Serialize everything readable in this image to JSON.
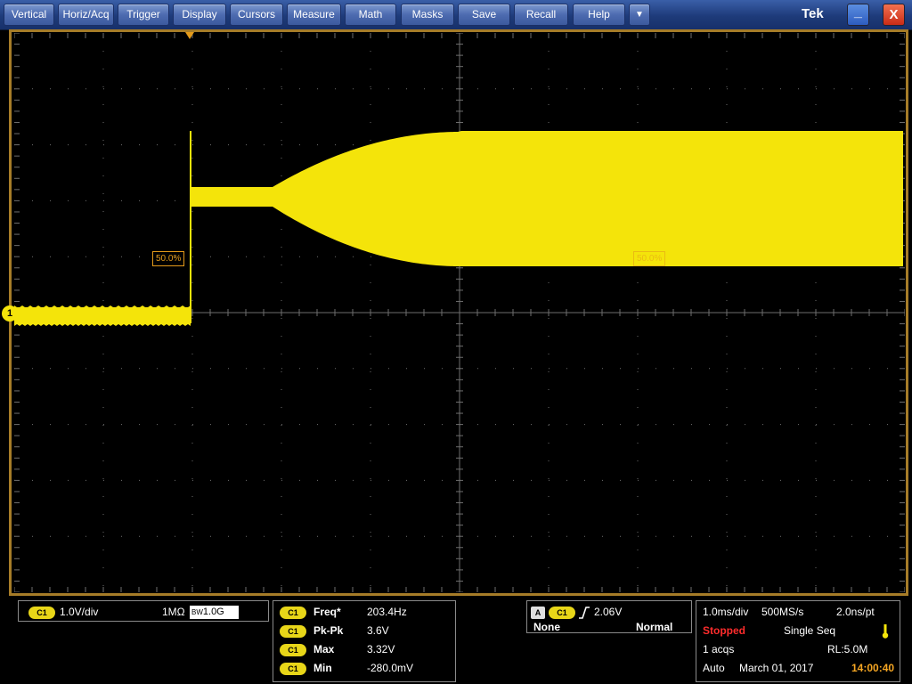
{
  "menu": {
    "items": [
      {
        "label": "Vertical",
        "name": "menu-vertical"
      },
      {
        "label": "Horiz/Acq",
        "name": "menu-horiz-acq"
      },
      {
        "label": "Trigger",
        "name": "menu-trigger"
      },
      {
        "label": "Display",
        "name": "menu-display"
      },
      {
        "label": "Cursors",
        "name": "menu-cursors"
      },
      {
        "label": "Measure",
        "name": "menu-measure"
      },
      {
        "label": "Math",
        "name": "menu-math"
      },
      {
        "label": "Masks",
        "name": "menu-masks"
      },
      {
        "label": "Save",
        "name": "menu-save"
      },
      {
        "label": "Recall",
        "name": "menu-recall"
      },
      {
        "label": "Help",
        "name": "menu-help"
      }
    ],
    "dropdown_icon": "chevron-down-icon",
    "dropdown_glyph": "▼"
  },
  "brand": "Tek",
  "window": {
    "minimize_glyph": "_",
    "close_glyph": "X"
  },
  "display": {
    "trigger_level_left": "50.0%",
    "trigger_level_right": "50.0%",
    "channel_marker": "1",
    "trace_color": "#f4e40a",
    "graticule_color": "#6e6e6e",
    "marker_color": "#e39a1a",
    "frame_color": "#a67c28"
  },
  "channel": {
    "badge": "C1",
    "scale": "1.0V/div",
    "impedance": "1MΩ",
    "bw_label": "BW",
    "bw_value": "1.0G"
  },
  "measurements": [
    {
      "badge": "C1",
      "label": "Freq*",
      "value": "203.4Hz"
    },
    {
      "badge": "C1",
      "label": "Pk-Pk",
      "value": "3.6V"
    },
    {
      "badge": "C1",
      "label": "Max",
      "value": "3.32V"
    },
    {
      "badge": "C1",
      "label": "Min",
      "value": "-280.0mV"
    }
  ],
  "trigger": {
    "type_badge": "A",
    "source_badge": "C1",
    "level": "2.06V",
    "coupling": "None",
    "mode": "Normal"
  },
  "acquisition": {
    "timebase": "1.0ms/div",
    "sample_rate": "500MS/s",
    "resolution": "2.0ns/pt",
    "state": "Stopped",
    "mode": "Single Seq",
    "acqs": "1 acqs",
    "record_length": "RL:5.0M",
    "trigger_mode": "Auto",
    "date": "March 01, 2017",
    "time": "14:00:40"
  }
}
